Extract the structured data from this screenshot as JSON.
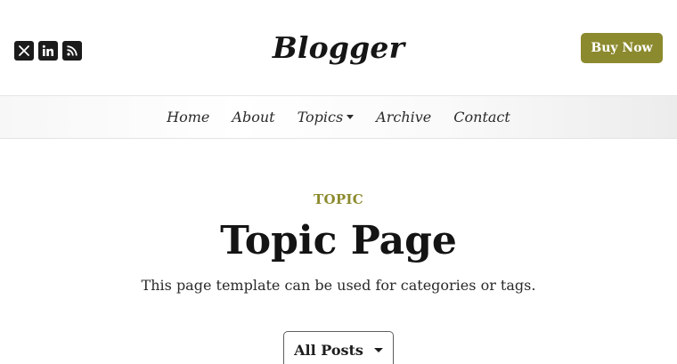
{
  "header": {
    "brand": "Blogger",
    "social": [
      {
        "icon": "x-twitter-icon"
      },
      {
        "icon": "linkedin-icon"
      },
      {
        "icon": "rss-icon"
      }
    ],
    "cta_label": "Buy Now",
    "accent_color": "#8c8a2e"
  },
  "nav": {
    "items": [
      {
        "label": "Home"
      },
      {
        "label": "About"
      },
      {
        "label": "Topics",
        "has_dropdown": true
      },
      {
        "label": "Archive"
      },
      {
        "label": "Contact"
      }
    ]
  },
  "main": {
    "kicker": "TOPIC",
    "title": "Topic Page",
    "description": "This page template can be used for categories or tags.",
    "filter": {
      "selected": "All Posts"
    }
  }
}
